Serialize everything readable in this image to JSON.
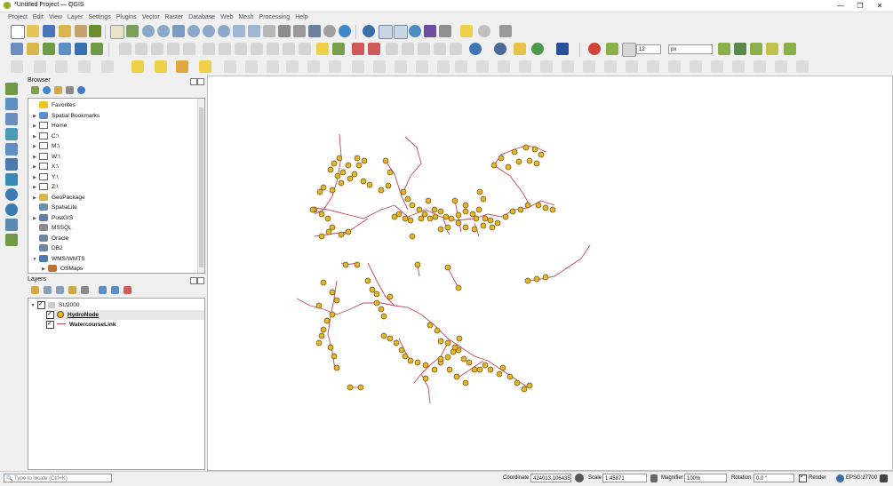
{
  "window": {
    "title": "*Untitled Project — QGIS",
    "controls": [
      "—",
      "❐",
      "✕"
    ]
  },
  "menubar": [
    "Project",
    "Edit",
    "View",
    "Layer",
    "Settings",
    "Plugins",
    "Vector",
    "Raster",
    "Database",
    "Web",
    "Mesh",
    "Processing",
    "Help"
  ],
  "toolbar": {
    "font_size_value": "12",
    "font_unit_value": "px"
  },
  "browser": {
    "title": "Browser",
    "items": [
      {
        "label": "Favorites",
        "expandable": false,
        "icon": "star-icon"
      },
      {
        "label": "Spatial Bookmarks",
        "expandable": true,
        "icon": "bookmark-icon"
      },
      {
        "label": "Home",
        "expandable": true,
        "icon": "folder-icon"
      },
      {
        "label": "C:\\",
        "expandable": true,
        "icon": "folder-icon"
      },
      {
        "label": "M:\\",
        "expandable": true,
        "icon": "folder-icon"
      },
      {
        "label": "W:\\",
        "expandable": true,
        "icon": "folder-icon"
      },
      {
        "label": "X:\\",
        "expandable": true,
        "icon": "folder-icon"
      },
      {
        "label": "Y:\\",
        "expandable": true,
        "icon": "folder-icon"
      },
      {
        "label": "Z:\\",
        "expandable": true,
        "icon": "folder-icon"
      },
      {
        "label": "GeoPackage",
        "expandable": true,
        "icon": "geopackage-icon"
      },
      {
        "label": "SpatiaLite",
        "expandable": false,
        "icon": "spatialite-icon"
      },
      {
        "label": "PostGIS",
        "expandable": true,
        "icon": "postgis-icon"
      },
      {
        "label": "MSSQL",
        "expandable": false,
        "icon": "mssql-icon"
      },
      {
        "label": "Oracle",
        "expandable": false,
        "icon": "oracle-icon"
      },
      {
        "label": "DB2",
        "expandable": false,
        "icon": "db2-icon"
      },
      {
        "label": "WMS/WMTS",
        "expandable": true,
        "icon": "globe-icon"
      },
      {
        "label": "OSMaps",
        "expandable": true,
        "icon": "osmaps-icon"
      }
    ]
  },
  "layers": {
    "title": "Layers",
    "group": "SU2000",
    "items": [
      {
        "label": "HydroNode",
        "kind": "point",
        "checked": true
      },
      {
        "label": "WatercourseLink",
        "kind": "line",
        "checked": true
      }
    ]
  },
  "statusbar": {
    "locate_placeholder": "Type to locate (Ctrl+K)",
    "coordinate_label": "Coordinate",
    "coordinate_value": "424013,106435",
    "scale_label": "Scale",
    "scale_value": "1:45871",
    "magnifier_label": "Magnifier",
    "magnifier_value": "100%",
    "rotation_label": "Rotation",
    "rotation_value": "0.0 °",
    "render_label": "Render",
    "crs_label": "EPSG:27700"
  },
  "colors": {
    "node_fill": "#e3b62b",
    "node_stroke": "#6b5210",
    "line_stroke": "#c8445a",
    "qgis_green": "#93b023"
  }
}
